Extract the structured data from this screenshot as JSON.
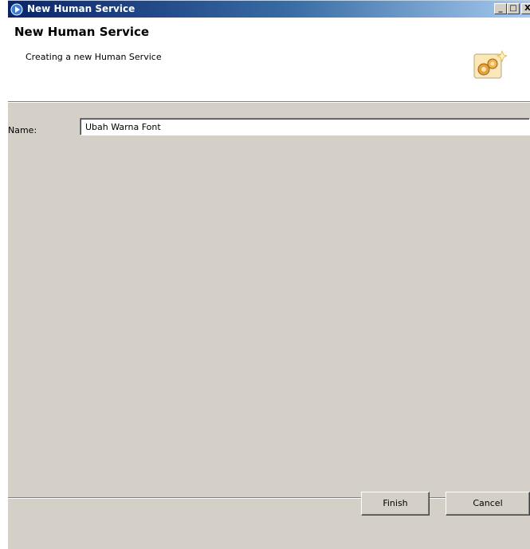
{
  "window": {
    "title": "New Human Service",
    "controls": {
      "minimize": "_",
      "maximize": "□",
      "close": "X"
    }
  },
  "header": {
    "title": "New Human Service",
    "description": "Creating a new Human Service",
    "icon": "wizard-gears-icon"
  },
  "form": {
    "name_label": "Name:",
    "name_value": "Ubah Warna Font"
  },
  "buttons": {
    "finish": "Finish",
    "cancel": "Cancel"
  },
  "colors": {
    "titlebar_start": "#0a246a",
    "titlebar_end": "#a6caf0",
    "dialog_bg": "#d4d0c8"
  }
}
